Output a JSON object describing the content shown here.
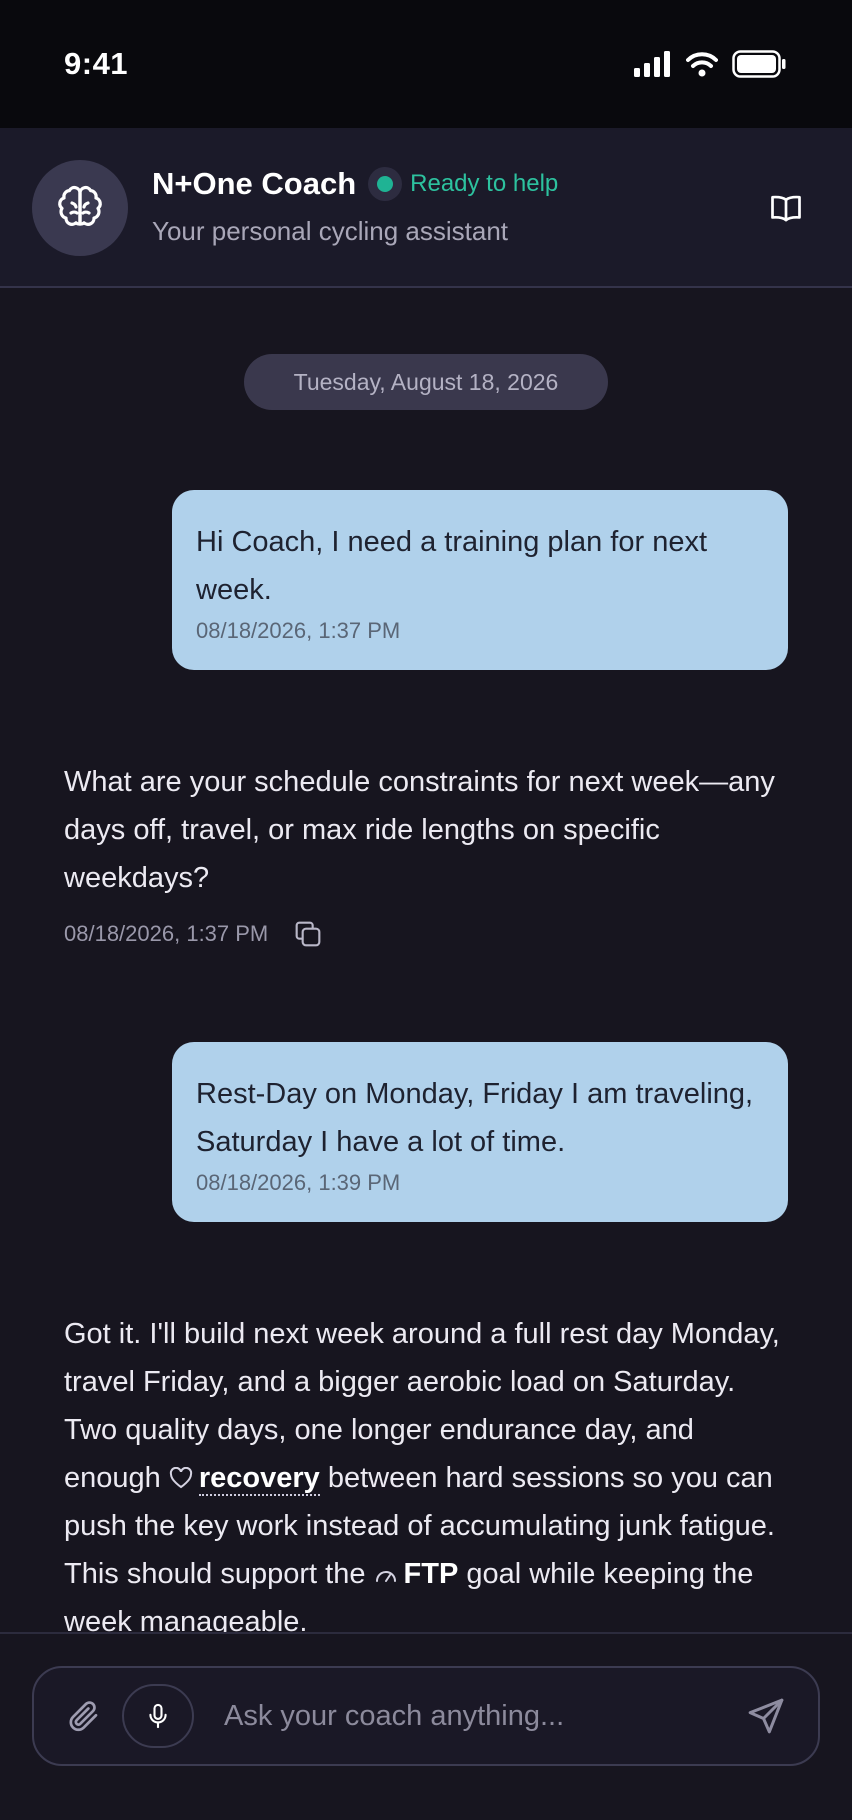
{
  "status_bar": {
    "time": "9:41"
  },
  "header": {
    "title": "N+One Coach",
    "status": "Ready to help",
    "subtitle": "Your personal cycling assistant"
  },
  "chat": {
    "date": "Tuesday, August 18, 2026",
    "messages": [
      {
        "role": "user",
        "text": "Hi Coach, I need a training plan for next week.",
        "timestamp": "08/18/2026, 1:37 PM"
      },
      {
        "role": "coach",
        "text": "What are your schedule constraints for next week—any days off, travel, or max ride lengths on specific weekdays?",
        "timestamp": "08/18/2026, 1:37 PM"
      },
      {
        "role": "user",
        "text": "Rest-Day on Monday, Friday I am traveling, Saturday I have a lot of time.",
        "timestamp": "08/18/2026, 1:39 PM"
      },
      {
        "role": "coach",
        "part1": "Got it. I'll build next week around a full rest day Monday, travel Friday, and a bigger aerobic load on Saturday. Two quality days, one longer endurance day, and enough ",
        "term1": "recovery",
        "part2": " between hard sessions so you can push the key work instead of accumulating junk fatigue. This should support the ",
        "term2": "FTP",
        "part3": " goal while keeping the week manageable."
      }
    ]
  },
  "input": {
    "placeholder": "Ask your coach anything..."
  },
  "colors": {
    "background": "#17151f",
    "header_bg": "#1b1a29",
    "user_bubble": "#b0d1eb",
    "status_green": "#2dc29f"
  }
}
